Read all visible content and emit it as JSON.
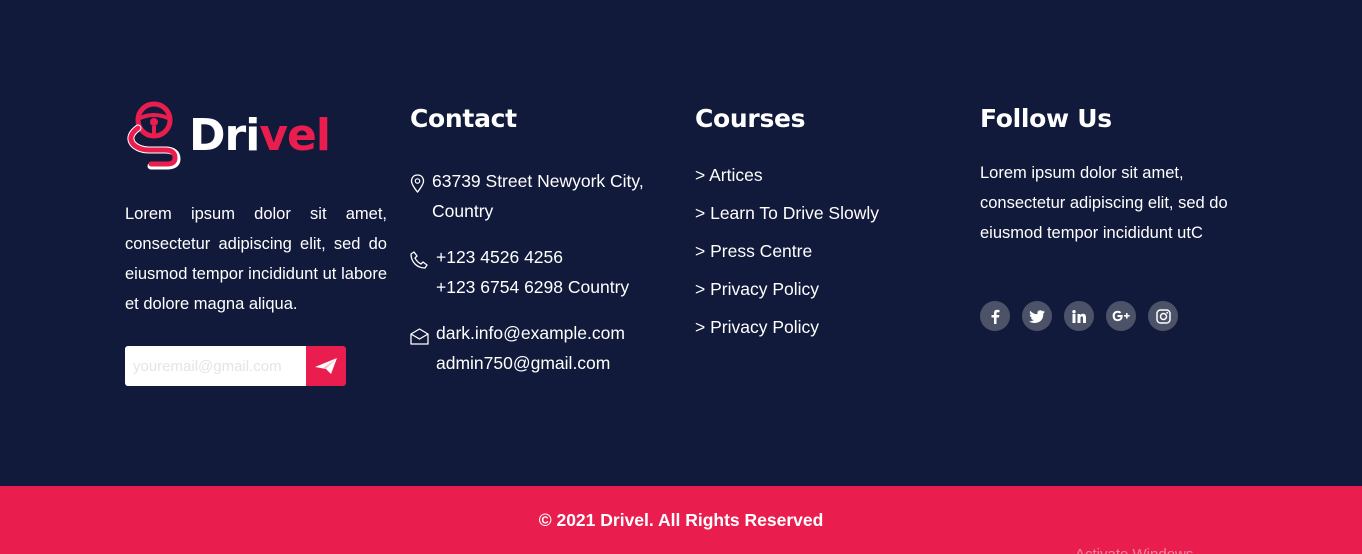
{
  "brand": {
    "logo_prefix": "Dri",
    "logo_accent": "vel",
    "description": "Lorem ipsum dolor sit amet, consectetur adipiscing elit, sed do eiusmod tempor incididunt ut labore et dolore magna aliqua.",
    "newsletter_placeholder": "youremail@gmail.com"
  },
  "contact": {
    "heading": "Contact",
    "address": [
      "63739 Street Newyork City,",
      "Country"
    ],
    "phones": [
      "+123 4526 4256",
      "+123 6754 6298 Country"
    ],
    "emails": [
      "dark.info@example.com",
      "admin750@gmail.com"
    ]
  },
  "courses": {
    "heading": "Courses",
    "links": [
      "> Artices",
      "> Learn To Drive Slowly",
      "> Press Centre",
      "> Privacy Policy",
      "> Privacy Policy"
    ]
  },
  "follow": {
    "heading": "Follow Us",
    "description": "Lorem ipsum dolor sit amet, consectetur adipiscing elit, sed do eiusmod tempor incididunt utC",
    "socials": [
      "facebook-icon",
      "twitter-icon",
      "linkedin-icon",
      "google-plus-icon",
      "instagram-icon"
    ]
  },
  "bottom": {
    "copyright": "© 2021 Drivel. All Rights Reserved",
    "watermark": "Activate Windows"
  },
  "colors": {
    "background": "#111a3b",
    "accent": "#e91e4f",
    "social_bg": "#4c5368"
  }
}
